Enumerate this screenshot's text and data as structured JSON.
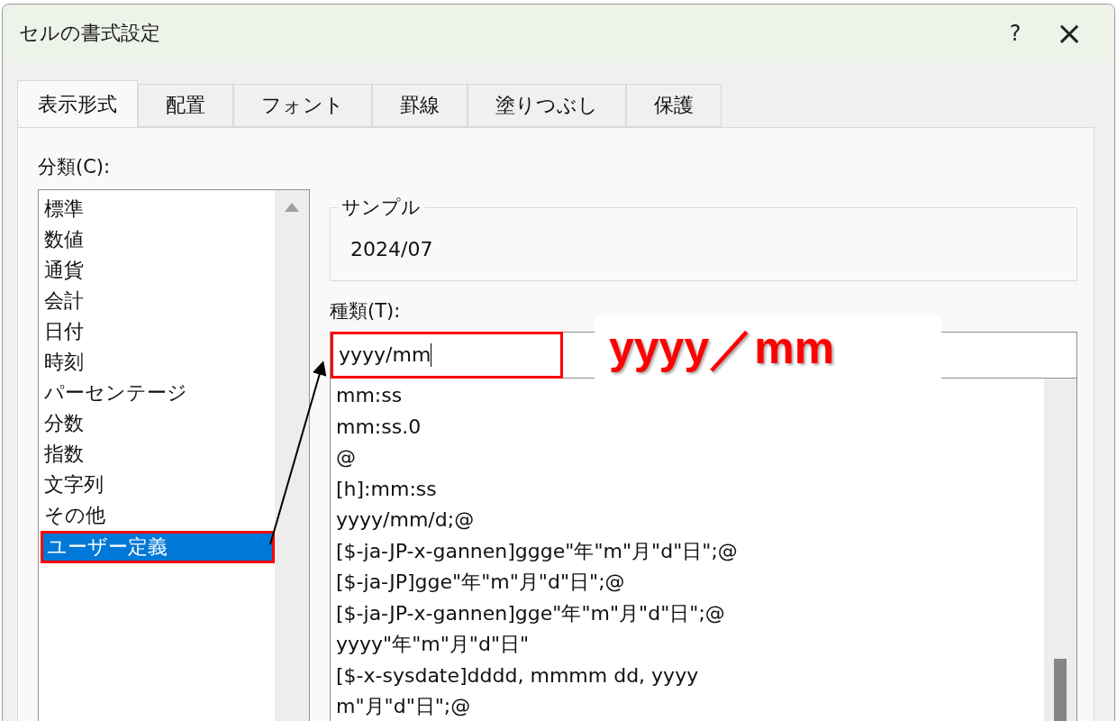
{
  "window": {
    "title": "セルの書式設定",
    "help": "?",
    "close": "×"
  },
  "tabs": [
    {
      "label": "表示形式",
      "selected": true
    },
    {
      "label": "配置",
      "selected": false
    },
    {
      "label": "フォント",
      "selected": false
    },
    {
      "label": "罫線",
      "selected": false
    },
    {
      "label": "塗りつぶし",
      "selected": false
    },
    {
      "label": "保護",
      "selected": false
    }
  ],
  "category": {
    "label": "分類(C):",
    "items": [
      {
        "label": "標準",
        "selected": false
      },
      {
        "label": "数値",
        "selected": false
      },
      {
        "label": "通貨",
        "selected": false
      },
      {
        "label": "会計",
        "selected": false
      },
      {
        "label": "日付",
        "selected": false
      },
      {
        "label": "時刻",
        "selected": false
      },
      {
        "label": "パーセンテージ",
        "selected": false
      },
      {
        "label": "分数",
        "selected": false
      },
      {
        "label": "指数",
        "selected": false
      },
      {
        "label": "文字列",
        "selected": false
      },
      {
        "label": "その他",
        "selected": false
      },
      {
        "label": "ユーザー定義",
        "selected": true
      }
    ]
  },
  "sample": {
    "label": "サンプル",
    "value": "2024/07"
  },
  "type": {
    "label": "種類(T):",
    "value": "yyyy/mm",
    "formats": [
      "mm:ss",
      "mm:ss.0",
      "@",
      "[h]:mm:ss",
      "yyyy/mm/d;@",
      "[$-ja-JP-x-gannen]ggge\"年\"m\"月\"d\"日\";@",
      "[$-ja-JP]gge\"年\"m\"月\"d\"日\";@",
      "[$-ja-JP-x-gannen]gge\"年\"m\"月\"d\"日\";@",
      "yyyy\"年\"m\"月\"d\"日\"",
      "[$-x-sysdate]dddd, mmmm dd, yyyy",
      "m\"月\"d\"日\";@"
    ]
  },
  "annotation": {
    "callout": "yyyy／mm"
  }
}
